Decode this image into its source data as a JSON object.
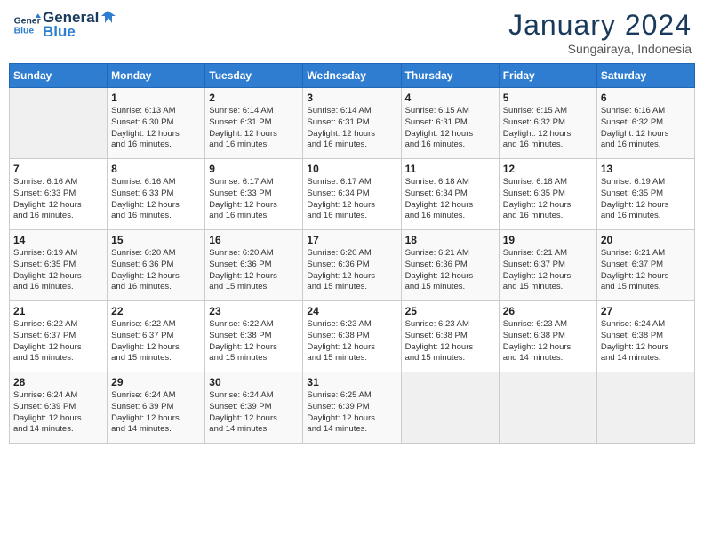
{
  "header": {
    "logo_line1": "General",
    "logo_line2": "Blue",
    "month": "January 2024",
    "location": "Sungairaya, Indonesia"
  },
  "weekdays": [
    "Sunday",
    "Monday",
    "Tuesday",
    "Wednesday",
    "Thursday",
    "Friday",
    "Saturday"
  ],
  "weeks": [
    [
      {
        "day": "",
        "info": ""
      },
      {
        "day": "1",
        "info": "Sunrise: 6:13 AM\nSunset: 6:30 PM\nDaylight: 12 hours\nand 16 minutes."
      },
      {
        "day": "2",
        "info": "Sunrise: 6:14 AM\nSunset: 6:31 PM\nDaylight: 12 hours\nand 16 minutes."
      },
      {
        "day": "3",
        "info": "Sunrise: 6:14 AM\nSunset: 6:31 PM\nDaylight: 12 hours\nand 16 minutes."
      },
      {
        "day": "4",
        "info": "Sunrise: 6:15 AM\nSunset: 6:31 PM\nDaylight: 12 hours\nand 16 minutes."
      },
      {
        "day": "5",
        "info": "Sunrise: 6:15 AM\nSunset: 6:32 PM\nDaylight: 12 hours\nand 16 minutes."
      },
      {
        "day": "6",
        "info": "Sunrise: 6:16 AM\nSunset: 6:32 PM\nDaylight: 12 hours\nand 16 minutes."
      }
    ],
    [
      {
        "day": "7",
        "info": "Sunrise: 6:16 AM\nSunset: 6:33 PM\nDaylight: 12 hours\nand 16 minutes."
      },
      {
        "day": "8",
        "info": "Sunrise: 6:16 AM\nSunset: 6:33 PM\nDaylight: 12 hours\nand 16 minutes."
      },
      {
        "day": "9",
        "info": "Sunrise: 6:17 AM\nSunset: 6:33 PM\nDaylight: 12 hours\nand 16 minutes."
      },
      {
        "day": "10",
        "info": "Sunrise: 6:17 AM\nSunset: 6:34 PM\nDaylight: 12 hours\nand 16 minutes."
      },
      {
        "day": "11",
        "info": "Sunrise: 6:18 AM\nSunset: 6:34 PM\nDaylight: 12 hours\nand 16 minutes."
      },
      {
        "day": "12",
        "info": "Sunrise: 6:18 AM\nSunset: 6:35 PM\nDaylight: 12 hours\nand 16 minutes."
      },
      {
        "day": "13",
        "info": "Sunrise: 6:19 AM\nSunset: 6:35 PM\nDaylight: 12 hours\nand 16 minutes."
      }
    ],
    [
      {
        "day": "14",
        "info": "Sunrise: 6:19 AM\nSunset: 6:35 PM\nDaylight: 12 hours\nand 16 minutes."
      },
      {
        "day": "15",
        "info": "Sunrise: 6:20 AM\nSunset: 6:36 PM\nDaylight: 12 hours\nand 16 minutes."
      },
      {
        "day": "16",
        "info": "Sunrise: 6:20 AM\nSunset: 6:36 PM\nDaylight: 12 hours\nand 15 minutes."
      },
      {
        "day": "17",
        "info": "Sunrise: 6:20 AM\nSunset: 6:36 PM\nDaylight: 12 hours\nand 15 minutes."
      },
      {
        "day": "18",
        "info": "Sunrise: 6:21 AM\nSunset: 6:36 PM\nDaylight: 12 hours\nand 15 minutes."
      },
      {
        "day": "19",
        "info": "Sunrise: 6:21 AM\nSunset: 6:37 PM\nDaylight: 12 hours\nand 15 minutes."
      },
      {
        "day": "20",
        "info": "Sunrise: 6:21 AM\nSunset: 6:37 PM\nDaylight: 12 hours\nand 15 minutes."
      }
    ],
    [
      {
        "day": "21",
        "info": "Sunrise: 6:22 AM\nSunset: 6:37 PM\nDaylight: 12 hours\nand 15 minutes."
      },
      {
        "day": "22",
        "info": "Sunrise: 6:22 AM\nSunset: 6:37 PM\nDaylight: 12 hours\nand 15 minutes."
      },
      {
        "day": "23",
        "info": "Sunrise: 6:22 AM\nSunset: 6:38 PM\nDaylight: 12 hours\nand 15 minutes."
      },
      {
        "day": "24",
        "info": "Sunrise: 6:23 AM\nSunset: 6:38 PM\nDaylight: 12 hours\nand 15 minutes."
      },
      {
        "day": "25",
        "info": "Sunrise: 6:23 AM\nSunset: 6:38 PM\nDaylight: 12 hours\nand 15 minutes."
      },
      {
        "day": "26",
        "info": "Sunrise: 6:23 AM\nSunset: 6:38 PM\nDaylight: 12 hours\nand 14 minutes."
      },
      {
        "day": "27",
        "info": "Sunrise: 6:24 AM\nSunset: 6:38 PM\nDaylight: 12 hours\nand 14 minutes."
      }
    ],
    [
      {
        "day": "28",
        "info": "Sunrise: 6:24 AM\nSunset: 6:39 PM\nDaylight: 12 hours\nand 14 minutes."
      },
      {
        "day": "29",
        "info": "Sunrise: 6:24 AM\nSunset: 6:39 PM\nDaylight: 12 hours\nand 14 minutes."
      },
      {
        "day": "30",
        "info": "Sunrise: 6:24 AM\nSunset: 6:39 PM\nDaylight: 12 hours\nand 14 minutes."
      },
      {
        "day": "31",
        "info": "Sunrise: 6:25 AM\nSunset: 6:39 PM\nDaylight: 12 hours\nand 14 minutes."
      },
      {
        "day": "",
        "info": ""
      },
      {
        "day": "",
        "info": ""
      },
      {
        "day": "",
        "info": ""
      }
    ]
  ]
}
